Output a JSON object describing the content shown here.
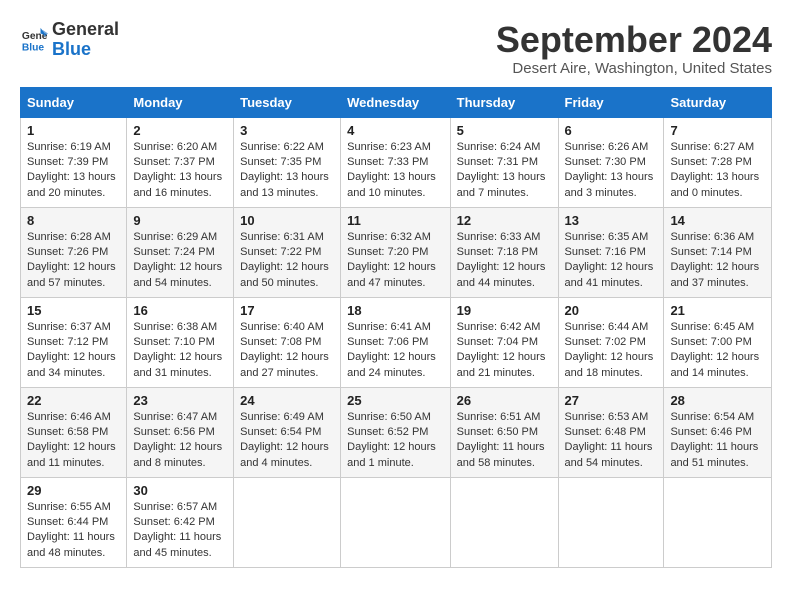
{
  "header": {
    "logo_line1": "General",
    "logo_line2": "Blue",
    "month": "September 2024",
    "location": "Desert Aire, Washington, United States"
  },
  "days_of_week": [
    "Sunday",
    "Monday",
    "Tuesday",
    "Wednesday",
    "Thursday",
    "Friday",
    "Saturday"
  ],
  "weeks": [
    [
      {
        "day": "1",
        "info": "Sunrise: 6:19 AM\nSunset: 7:39 PM\nDaylight: 13 hours\nand 20 minutes."
      },
      {
        "day": "2",
        "info": "Sunrise: 6:20 AM\nSunset: 7:37 PM\nDaylight: 13 hours\nand 16 minutes."
      },
      {
        "day": "3",
        "info": "Sunrise: 6:22 AM\nSunset: 7:35 PM\nDaylight: 13 hours\nand 13 minutes."
      },
      {
        "day": "4",
        "info": "Sunrise: 6:23 AM\nSunset: 7:33 PM\nDaylight: 13 hours\nand 10 minutes."
      },
      {
        "day": "5",
        "info": "Sunrise: 6:24 AM\nSunset: 7:31 PM\nDaylight: 13 hours\nand 7 minutes."
      },
      {
        "day": "6",
        "info": "Sunrise: 6:26 AM\nSunset: 7:30 PM\nDaylight: 13 hours\nand 3 minutes."
      },
      {
        "day": "7",
        "info": "Sunrise: 6:27 AM\nSunset: 7:28 PM\nDaylight: 13 hours\nand 0 minutes."
      }
    ],
    [
      {
        "day": "8",
        "info": "Sunrise: 6:28 AM\nSunset: 7:26 PM\nDaylight: 12 hours\nand 57 minutes."
      },
      {
        "day": "9",
        "info": "Sunrise: 6:29 AM\nSunset: 7:24 PM\nDaylight: 12 hours\nand 54 minutes."
      },
      {
        "day": "10",
        "info": "Sunrise: 6:31 AM\nSunset: 7:22 PM\nDaylight: 12 hours\nand 50 minutes."
      },
      {
        "day": "11",
        "info": "Sunrise: 6:32 AM\nSunset: 7:20 PM\nDaylight: 12 hours\nand 47 minutes."
      },
      {
        "day": "12",
        "info": "Sunrise: 6:33 AM\nSunset: 7:18 PM\nDaylight: 12 hours\nand 44 minutes."
      },
      {
        "day": "13",
        "info": "Sunrise: 6:35 AM\nSunset: 7:16 PM\nDaylight: 12 hours\nand 41 minutes."
      },
      {
        "day": "14",
        "info": "Sunrise: 6:36 AM\nSunset: 7:14 PM\nDaylight: 12 hours\nand 37 minutes."
      }
    ],
    [
      {
        "day": "15",
        "info": "Sunrise: 6:37 AM\nSunset: 7:12 PM\nDaylight: 12 hours\nand 34 minutes."
      },
      {
        "day": "16",
        "info": "Sunrise: 6:38 AM\nSunset: 7:10 PM\nDaylight: 12 hours\nand 31 minutes."
      },
      {
        "day": "17",
        "info": "Sunrise: 6:40 AM\nSunset: 7:08 PM\nDaylight: 12 hours\nand 27 minutes."
      },
      {
        "day": "18",
        "info": "Sunrise: 6:41 AM\nSunset: 7:06 PM\nDaylight: 12 hours\nand 24 minutes."
      },
      {
        "day": "19",
        "info": "Sunrise: 6:42 AM\nSunset: 7:04 PM\nDaylight: 12 hours\nand 21 minutes."
      },
      {
        "day": "20",
        "info": "Sunrise: 6:44 AM\nSunset: 7:02 PM\nDaylight: 12 hours\nand 18 minutes."
      },
      {
        "day": "21",
        "info": "Sunrise: 6:45 AM\nSunset: 7:00 PM\nDaylight: 12 hours\nand 14 minutes."
      }
    ],
    [
      {
        "day": "22",
        "info": "Sunrise: 6:46 AM\nSunset: 6:58 PM\nDaylight: 12 hours\nand 11 minutes."
      },
      {
        "day": "23",
        "info": "Sunrise: 6:47 AM\nSunset: 6:56 PM\nDaylight: 12 hours\nand 8 minutes."
      },
      {
        "day": "24",
        "info": "Sunrise: 6:49 AM\nSunset: 6:54 PM\nDaylight: 12 hours\nand 4 minutes."
      },
      {
        "day": "25",
        "info": "Sunrise: 6:50 AM\nSunset: 6:52 PM\nDaylight: 12 hours\nand 1 minute."
      },
      {
        "day": "26",
        "info": "Sunrise: 6:51 AM\nSunset: 6:50 PM\nDaylight: 11 hours\nand 58 minutes."
      },
      {
        "day": "27",
        "info": "Sunrise: 6:53 AM\nSunset: 6:48 PM\nDaylight: 11 hours\nand 54 minutes."
      },
      {
        "day": "28",
        "info": "Sunrise: 6:54 AM\nSunset: 6:46 PM\nDaylight: 11 hours\nand 51 minutes."
      }
    ],
    [
      {
        "day": "29",
        "info": "Sunrise: 6:55 AM\nSunset: 6:44 PM\nDaylight: 11 hours\nand 48 minutes."
      },
      {
        "day": "30",
        "info": "Sunrise: 6:57 AM\nSunset: 6:42 PM\nDaylight: 11 hours\nand 45 minutes."
      },
      {
        "day": "",
        "info": ""
      },
      {
        "day": "",
        "info": ""
      },
      {
        "day": "",
        "info": ""
      },
      {
        "day": "",
        "info": ""
      },
      {
        "day": "",
        "info": ""
      }
    ]
  ]
}
